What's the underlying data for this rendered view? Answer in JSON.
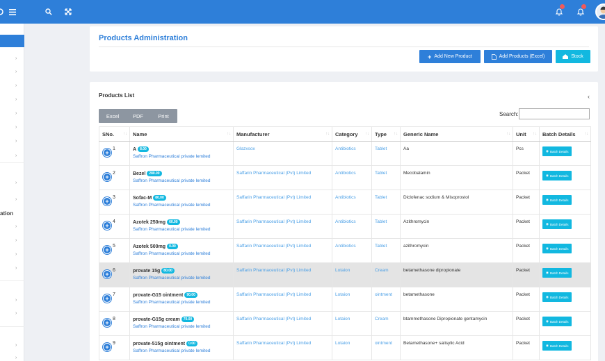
{
  "topbar": {
    "color": "#2e7fd9"
  },
  "header": {
    "title": "Products Administration",
    "buttons": {
      "add_new": "Add New Product",
      "add_excel": "Add Products (Excel)",
      "stock": "Stock"
    }
  },
  "sidebar": {
    "section_text": "ation"
  },
  "list": {
    "title": "Products List",
    "export": [
      "Excel",
      "PDF",
      "Print"
    ],
    "search_label": "Search:",
    "columns": [
      "SNo.",
      "Name",
      "Manufacturer",
      "Category",
      "Type",
      "Generic Name",
      "Unit",
      "Batch Details"
    ],
    "batch_label": "Batch Details",
    "rows": [
      {
        "sno": "1",
        "name": "A",
        "price": "8.00",
        "sub": "Saffron Pharmaceutical private lemited",
        "manufacturer": "Glazxsox",
        "category": "Antibiotics",
        "type": "Tablet",
        "generic": "Aa",
        "unit": "Pcs"
      },
      {
        "sno": "2",
        "name": "Bezel",
        "price": "280.00",
        "sub": "Saffron Pharmaceutical private lemited",
        "manufacturer": "Saffarin Pharmaceutical (Pvt) Limited",
        "category": "Antibiotics",
        "type": "Tablet",
        "generic": "Mecobalamin",
        "unit": "Packet"
      },
      {
        "sno": "3",
        "name": "Sofac-M",
        "price": "80.00",
        "sub": "Saffron Pharmaceutical private lemited",
        "manufacturer": "Saffarin Pharmaceutical (Pvt) Limited",
        "category": "Antibiotics",
        "type": "Tablet",
        "generic": "Diclofenac sodium & Misoprostol",
        "unit": "Packet"
      },
      {
        "sno": "4",
        "name": "Azotek 250mg",
        "price": "60.00",
        "sub": "Saffron Pharmaceutical private lemited",
        "manufacturer": "Saffarin Pharmaceutical (Pvt) Limited",
        "category": "Antibiotics",
        "type": "Tablet",
        "generic": "Azithromycin",
        "unit": "Packet"
      },
      {
        "sno": "5",
        "name": "Azotek 500mg",
        "price": "0.00",
        "sub": "Saffron Pharmaceutical private lemited",
        "manufacturer": "Saffarin Pharmaceutical (Pvt) Limited",
        "category": "Antibiotics",
        "type": "Tablet",
        "generic": "azithromycin",
        "unit": "Packet"
      },
      {
        "sno": "6",
        "name": "provate 15g",
        "price": "80.00",
        "sub": "Saffron Pharmaceutical private lemited",
        "manufacturer": "Saffarin Pharmaceutical (Pvt) Limited",
        "category": "Lotaion",
        "type": "Cream",
        "generic": "betamethasone dipropionate",
        "unit": "Packet",
        "highlight": true
      },
      {
        "sno": "7",
        "name": "provate-G15 ointment",
        "price": "90.00",
        "sub": "Saffron Pharmaceutical private lemited",
        "manufacturer": "Saffarin Pharmaceutical (Pvt) Limited",
        "category": "Lotaion",
        "type": "ointment",
        "generic": "betamethasone",
        "unit": "Packet"
      },
      {
        "sno": "8",
        "name": "provate-G15g cream",
        "price": "70.00",
        "sub": "Saffron Pharmaceutical private lemited",
        "manufacturer": "Saffarin Pharmaceutical (Pvt) Limited",
        "category": "Lotaion",
        "type": "Cream",
        "generic": "btammethasone Dipropionate gentamycin",
        "unit": "Packet"
      },
      {
        "sno": "9",
        "name": "provate-515g ointment",
        "price": "0.00",
        "sub": "Saffron Pharmaceutical private lemited",
        "manufacturer": "Saffarin Pharmaceutical (Pvt) Limited",
        "category": "Lotaion",
        "type": "ointment",
        "generic": "Betamethasone+ salisylic Acid",
        "unit": "Packet"
      }
    ]
  }
}
